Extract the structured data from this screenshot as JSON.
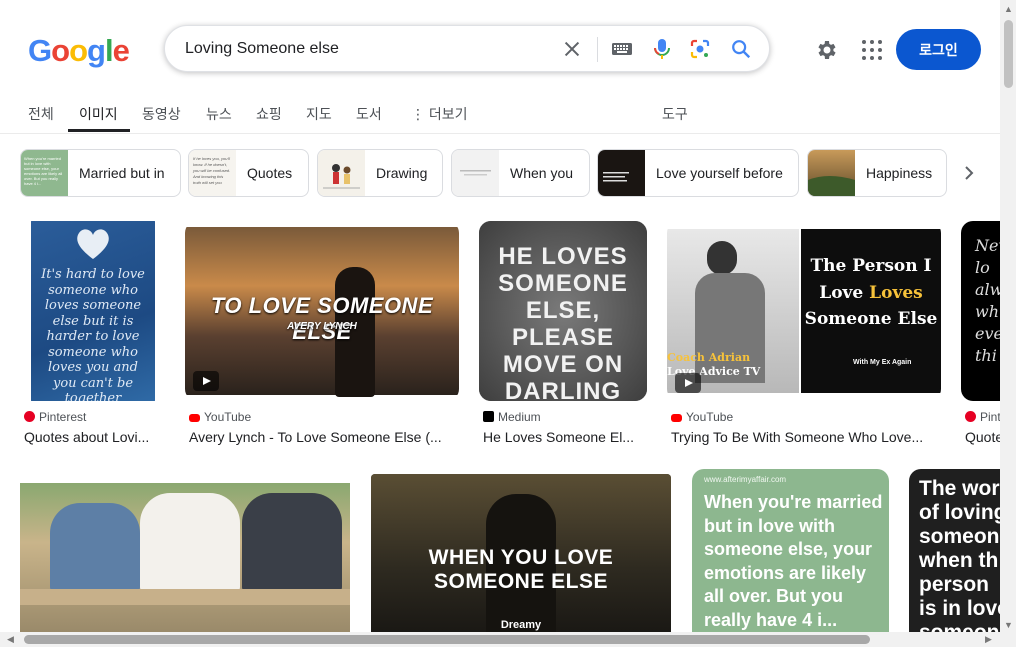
{
  "header": {
    "logo_letters": [
      "G",
      "o",
      "o",
      "g",
      "l",
      "e"
    ],
    "search_value": "Loving Someone else",
    "login_label": "로그인",
    "icons": [
      "clear-icon",
      "keyboard-icon",
      "microphone-icon",
      "google-lens-icon",
      "search-icon",
      "gear-icon",
      "apps-grid-icon"
    ]
  },
  "tabs": [
    {
      "label": "전체"
    },
    {
      "label": "이미지"
    },
    {
      "label": "동영상"
    },
    {
      "label": "뉴스"
    },
    {
      "label": "쇼핑"
    },
    {
      "label": "지도"
    },
    {
      "label": "도서"
    },
    {
      "label": "더보기"
    },
    {
      "label": "도구"
    }
  ],
  "chips": [
    {
      "label": "Married but in"
    },
    {
      "label": "Quotes"
    },
    {
      "label": "Drawing"
    },
    {
      "label": "When you"
    },
    {
      "label": "Love yourself before"
    },
    {
      "label": "Happiness"
    }
  ],
  "chip_thumb_text": {
    "married": "When you're married but in love with someone else, your emotions are likely all over. But you really have 4 i...",
    "quotes": "If he loves you, you'll know. If he doesn't, you will be confused. And knowing this truth will set you"
  },
  "results_row1": [
    {
      "source": "Pinterest",
      "caption": "Quotes about Lovi...",
      "image_text": "It's hard to love someone who loves someone else but it is harder to love someone who loves you and you can't be together"
    },
    {
      "source": "YouTube",
      "caption": "Avery Lynch - To Love Someone Else (...",
      "image_text": "TO LOVE SOMEONE ELSE",
      "image_subtext": "AVERY LYNCH"
    },
    {
      "source": "Medium",
      "caption": "He Loves Someone El...",
      "image_text": "HE LOVES SOMEONE ELSE, PLEASE MOVE ON DARLING"
    },
    {
      "source": "YouTube",
      "caption": "Trying To Be With Someone Who Love...",
      "image_text_1": "The Person I",
      "image_text_2": "Love",
      "image_text_3": "Loves",
      "image_text_4": "Someone Else",
      "image_badge": "With My Ex Again",
      "image_name_1": "Coach Adrian",
      "image_name_2": "Love Advice TV"
    },
    {
      "source": "Pint",
      "caption": "Quote",
      "image_text": "Nev lo alw wh eve thi"
    }
  ],
  "results_row2": [
    {
      "image_text": ""
    },
    {
      "image_text": "WHEN YOU LOVE SOMEONE ELSE",
      "image_subtext": "Dreamy"
    },
    {
      "image_site": "www.afterimyaffair.com",
      "image_text": "When you're married but in love with someone else, your emotions are likely all over. But you really have 4 i..."
    },
    {
      "image_text": "The wor of loving someon when th person is in love someon"
    }
  ],
  "colors": {
    "accent": "#0b57d0",
    "pinterest": "#e60023",
    "youtube": "#ff0000",
    "medium": "#000000"
  }
}
